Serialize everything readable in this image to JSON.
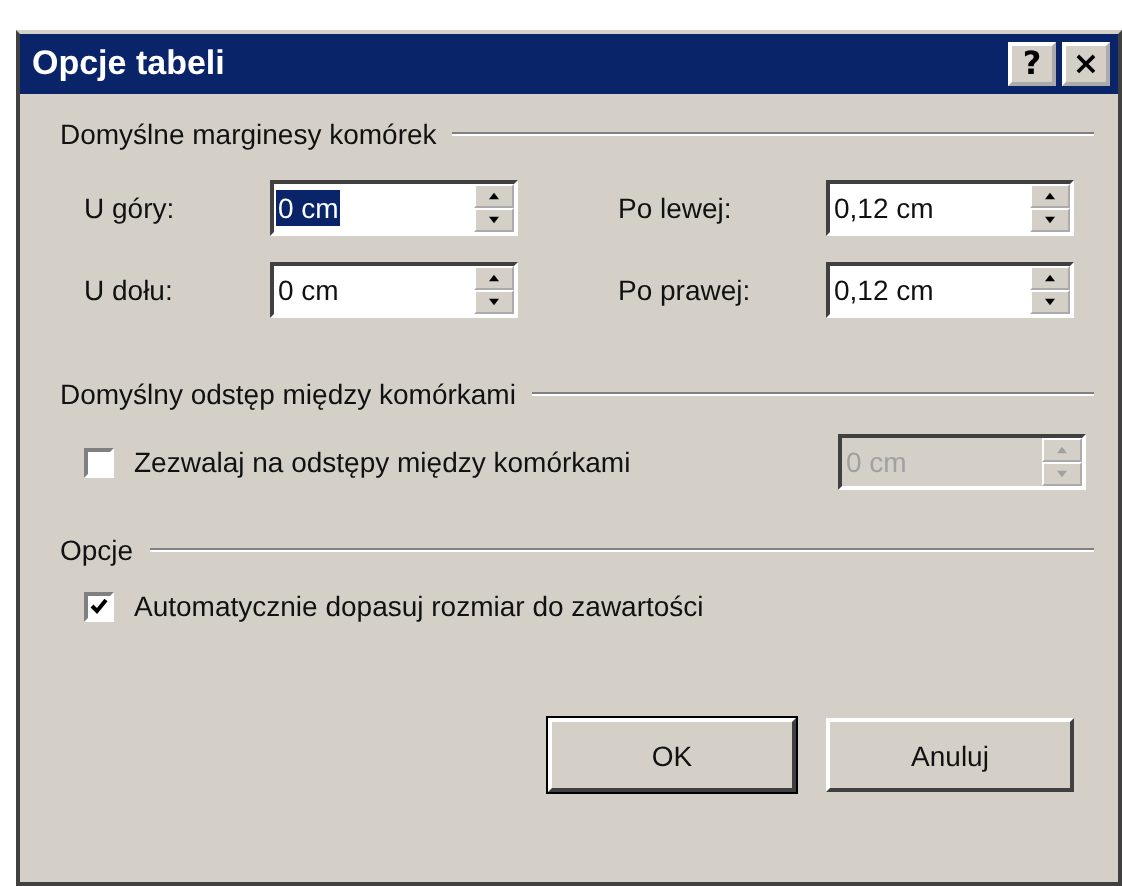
{
  "window": {
    "title": "Opcje tabeli",
    "title_buttons": [
      "?",
      "×"
    ]
  },
  "margins": {
    "title": "Domyślne marginesy komórek",
    "fields": [
      {
        "label": "U góry:",
        "value": "0 cm",
        "focused": true
      },
      {
        "label": "Po lewej:",
        "value": "0,12 cm",
        "focused": false
      },
      {
        "label": "U dołu:",
        "value": "0 cm",
        "focused": false
      },
      {
        "label": "Po prawej:",
        "value": "0,12 cm",
        "focused": false
      }
    ]
  },
  "spacing": {
    "title": "Domyślny odstęp między komórkami",
    "checkbox": {
      "label": "Zezwalaj na odstępy między komórkami",
      "checked": false
    },
    "field": {
      "value": "0 cm",
      "disabled": true
    }
  },
  "options": {
    "title": "Opcje",
    "checkbox": {
      "label": "Automatycznie dopasuj rozmiar do zawartości",
      "checked": true
    }
  },
  "buttons": [
    {
      "label": "OK",
      "default": true
    },
    {
      "label": "Anuluj",
      "default": false
    }
  ]
}
